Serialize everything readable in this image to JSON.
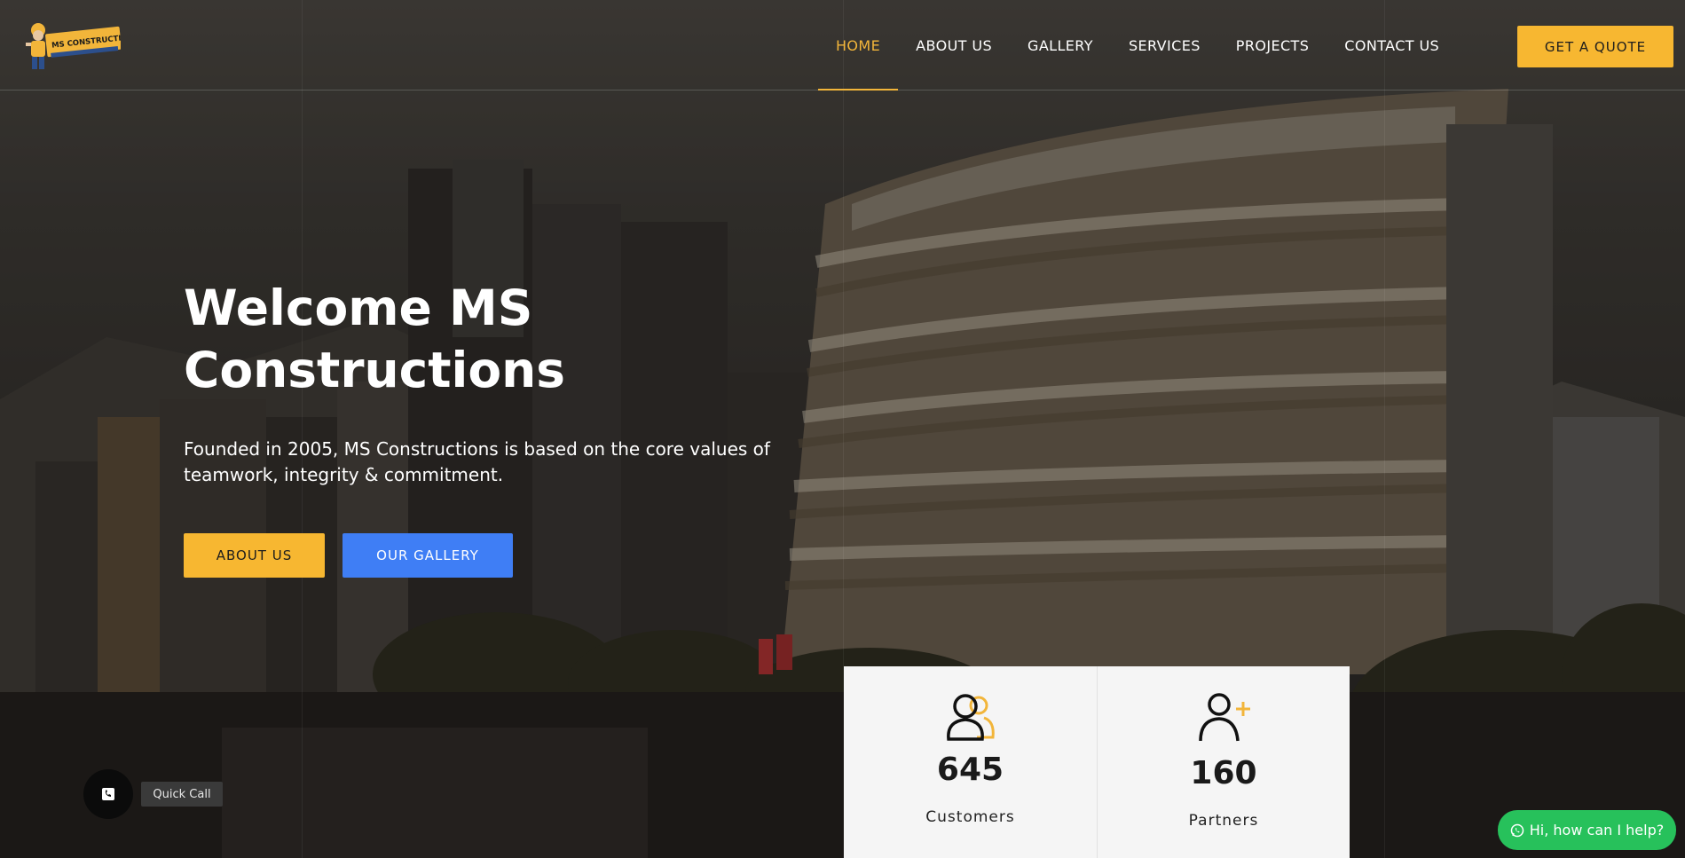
{
  "header": {
    "logo_text": "MS CONSTRUCTIONS",
    "nav": [
      {
        "label": "HOME",
        "active": true
      },
      {
        "label": "ABOUT US",
        "active": false
      },
      {
        "label": "GALLERY",
        "active": false
      },
      {
        "label": "SERVICES",
        "active": false
      },
      {
        "label": "PROJECTS",
        "active": false
      },
      {
        "label": "CONTACT US",
        "active": false
      }
    ],
    "quote_label": "GET A QUOTE"
  },
  "hero": {
    "title_line1": "Welcome MS",
    "title_line2": "Constructions",
    "subtitle_line1": "Founded in 2005, MS Constructions is based on the core values of",
    "subtitle_line2": "teamwork, integrity & commitment.",
    "about_button": "ABOUT US",
    "gallery_button": "OUR GALLERY"
  },
  "stats": [
    {
      "icon": "users-icon",
      "value": "645",
      "label": "Customers"
    },
    {
      "icon": "user-plus-icon",
      "value": "160",
      "label": "Partners"
    }
  ],
  "widgets": {
    "quick_call_label": "Quick Call",
    "whatsapp_label": "Hi, how can I help?"
  },
  "colors": {
    "accent": "#f7b731",
    "blue": "#3f7ef5",
    "whatsapp": "#27c15b"
  }
}
